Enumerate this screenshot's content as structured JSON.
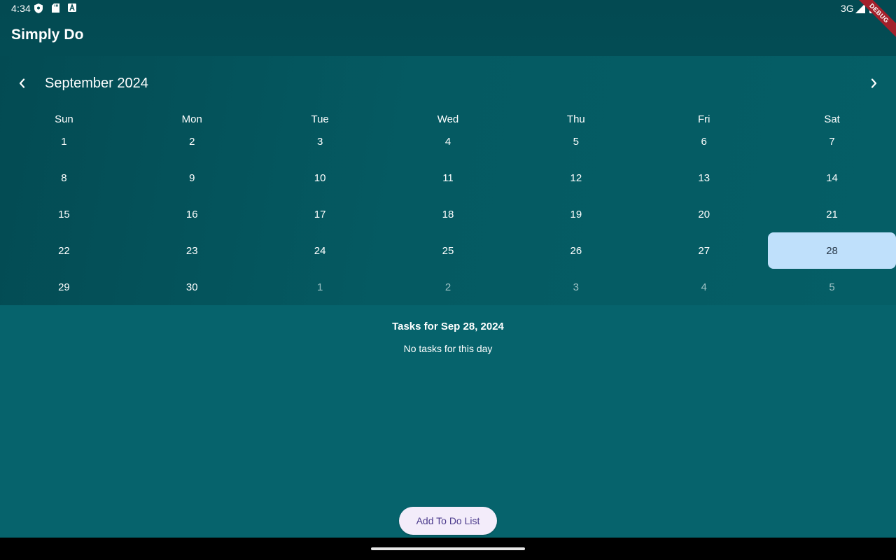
{
  "status_bar": {
    "time": "4:34",
    "network": "3G",
    "icons": [
      "shield-icon",
      "sd-card-icon",
      "a-icon",
      "signal-icon",
      "battery-icon"
    ]
  },
  "app_bar": {
    "title": "Simply Do",
    "debug_banner": "DEBUG"
  },
  "calendar": {
    "month_label": "September 2024",
    "prev_icon": "chevron-left-icon",
    "next_icon": "chevron-right-icon",
    "weekdays": [
      "Sun",
      "Mon",
      "Tue",
      "Wed",
      "Thu",
      "Fri",
      "Sat"
    ],
    "weeks": [
      [
        {
          "d": "1"
        },
        {
          "d": "2"
        },
        {
          "d": "3"
        },
        {
          "d": "4"
        },
        {
          "d": "5"
        },
        {
          "d": "6"
        },
        {
          "d": "7"
        }
      ],
      [
        {
          "d": "8"
        },
        {
          "d": "9"
        },
        {
          "d": "10"
        },
        {
          "d": "11"
        },
        {
          "d": "12"
        },
        {
          "d": "13"
        },
        {
          "d": "14"
        }
      ],
      [
        {
          "d": "15"
        },
        {
          "d": "16"
        },
        {
          "d": "17"
        },
        {
          "d": "18"
        },
        {
          "d": "19"
        },
        {
          "d": "20"
        },
        {
          "d": "21"
        }
      ],
      [
        {
          "d": "22"
        },
        {
          "d": "23"
        },
        {
          "d": "24"
        },
        {
          "d": "25"
        },
        {
          "d": "26"
        },
        {
          "d": "27"
        },
        {
          "d": "28",
          "selected": true
        }
      ],
      [
        {
          "d": "29"
        },
        {
          "d": "30"
        },
        {
          "d": "1",
          "outside": true
        },
        {
          "d": "2",
          "outside": true
        },
        {
          "d": "3",
          "outside": true
        },
        {
          "d": "4",
          "outside": true
        },
        {
          "d": "5",
          "outside": true
        }
      ]
    ],
    "selected_color": "#bfe0fb"
  },
  "tasks": {
    "title": "Tasks for Sep 28, 2024",
    "empty_message": "No tasks for this day"
  },
  "actions": {
    "add_label": "Add To Do List"
  },
  "colors": {
    "background": "#06636c",
    "app_bar": "#034a52",
    "button_bg": "#f3ecfa",
    "button_text": "#4b3a8c"
  }
}
